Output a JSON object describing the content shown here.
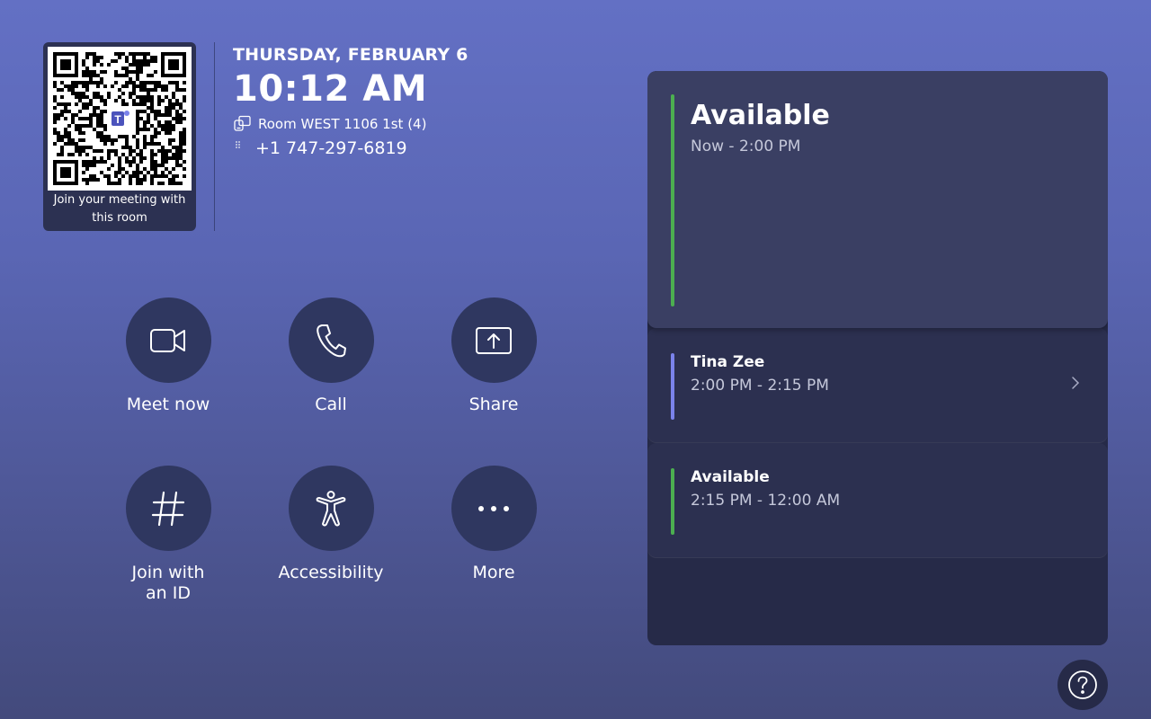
{
  "qr": {
    "caption_line1": "Join your meeting with",
    "caption_line2": "this room"
  },
  "header": {
    "date": "THURSDAY, FEBRUARY 6",
    "time": "10:12 AM",
    "room": "Room WEST 1106 1st (4)",
    "phone": "+1 747-297-6819"
  },
  "actions": [
    {
      "label": "Meet now",
      "icon": "video-camera-icon"
    },
    {
      "label": "Call",
      "icon": "phone-icon"
    },
    {
      "label": "Share",
      "icon": "share-screen-icon"
    },
    {
      "label_line1": "Join with",
      "label_line2": "an ID",
      "icon": "hash-icon"
    },
    {
      "label": "Accessibility",
      "icon": "accessibility-icon"
    },
    {
      "label": "More",
      "icon": "more-dots-icon"
    }
  ],
  "calendar": {
    "current": {
      "title": "Available",
      "time": "Now - 2:00 PM",
      "color": "#4caf50"
    },
    "items": [
      {
        "title": "Tina Zee",
        "time": "2:00 PM - 2:15 PM",
        "color": "#7b83eb"
      },
      {
        "title": "Available",
        "time": "2:15 PM - 12:00 AM",
        "color": "#4caf50"
      }
    ]
  },
  "colors": {
    "background": "#5a66b4",
    "panel": "#262a48",
    "button": "#2f3760"
  },
  "help": {
    "icon": "help-icon"
  }
}
